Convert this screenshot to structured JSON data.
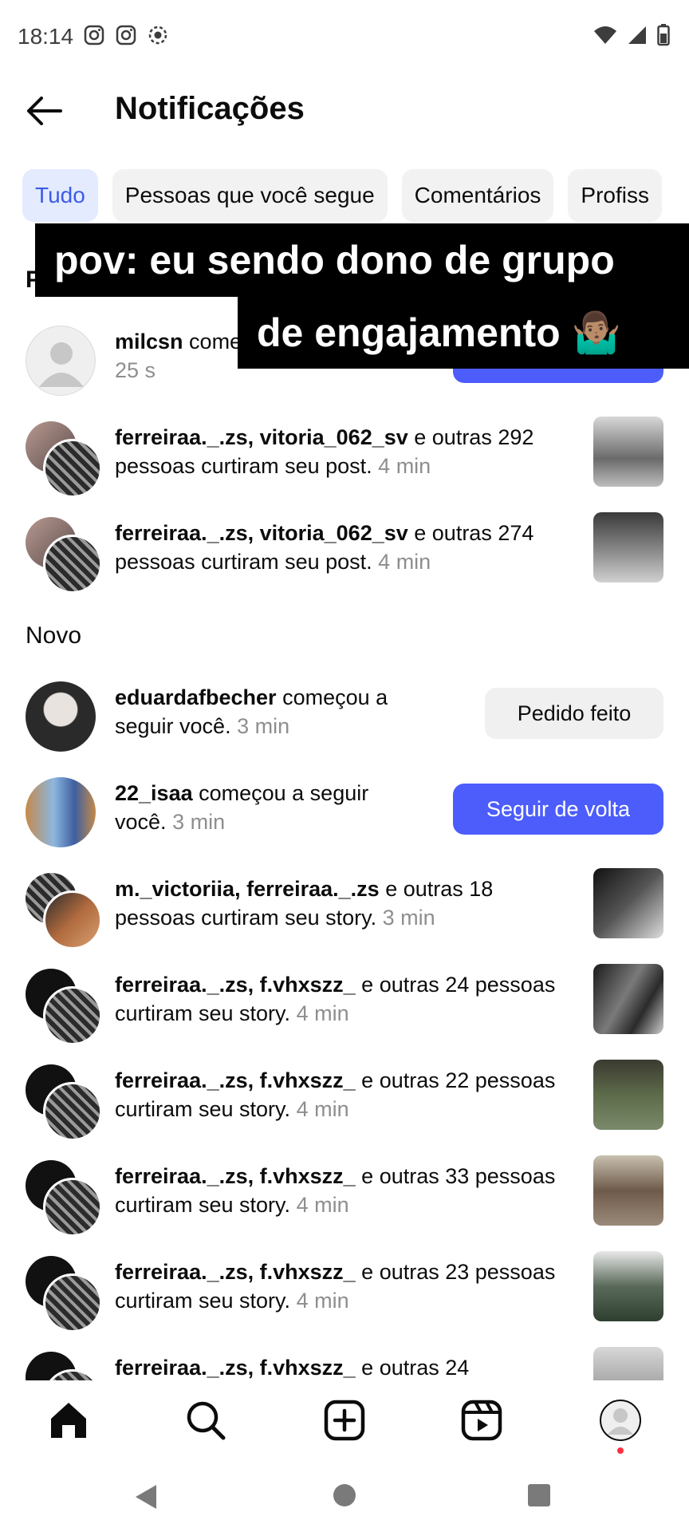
{
  "status_bar": {
    "time": "18:14"
  },
  "header": {
    "title": "Notificações"
  },
  "tabs": [
    {
      "label": "Tudo",
      "active": true
    },
    {
      "label": "Pessoas que você segue",
      "active": false
    },
    {
      "label": "Comentários",
      "active": false
    },
    {
      "label": "Profiss",
      "active": false
    }
  ],
  "overlay": {
    "line1": "pov: eu sendo dono de grupo",
    "line2": "de engajamento 🤷🏽‍♂️"
  },
  "sections": {
    "partial_header": "P",
    "new": "Novo"
  },
  "notifications_top": [
    {
      "user": "milcsn",
      "text": " come",
      "time": "25 s"
    },
    {
      "user": "ferreiraa._.zs, vitoria_062_sv",
      "text": " e outras 292 pessoas curtiram seu post.",
      "time": "4 min"
    },
    {
      "user": "ferreiraa._.zs, vitoria_062_sv",
      "text": " e outras 274 pessoas curtiram seu post.",
      "time": "4 min"
    }
  ],
  "notifications_new": [
    {
      "user": "eduardafbecher",
      "text": " começou a seguir você.",
      "time": "3 min",
      "button": "Pedido feito"
    },
    {
      "user": "22_isaa",
      "text": " começou a seguir você.",
      "time": "3 min",
      "button": "Seguir de volta"
    },
    {
      "user": "m._victoriia, ferreiraa._.zs",
      "text": " e outras 18 pessoas curtiram seu story.",
      "time": "3 min"
    },
    {
      "user": "ferreiraa._.zs, f.vhxszz_",
      "text": " e outras 24 pessoas curtiram seu story.",
      "time": "4 min"
    },
    {
      "user": "ferreiraa._.zs, f.vhxszz_",
      "text": " e outras 22 pessoas curtiram seu story.",
      "time": "4 min"
    },
    {
      "user": "ferreiraa._.zs, f.vhxszz_",
      "text": " e outras 33 pessoas curtiram seu story.",
      "time": "4 min"
    },
    {
      "user": "ferreiraa._.zs, f.vhxszz_",
      "text": " e outras 23 pessoas curtiram seu story.",
      "time": "4 min"
    },
    {
      "user": "ferreiraa._.zs, f.vhxszz_",
      "text": " e outras 24",
      "time": ""
    }
  ],
  "icons": {
    "back": "arrow-left-icon",
    "nav": [
      "home-icon",
      "search-icon",
      "create-icon",
      "reels-icon",
      "profile-icon"
    ],
    "system": [
      "back-triangle-icon",
      "home-circle-icon",
      "recents-square-icon"
    ]
  },
  "colors": {
    "accent": "#4c5dfb",
    "tab_active_bg": "#e4ebff",
    "tab_active_text": "#3d5ce5",
    "muted": "#8e8e8e"
  }
}
